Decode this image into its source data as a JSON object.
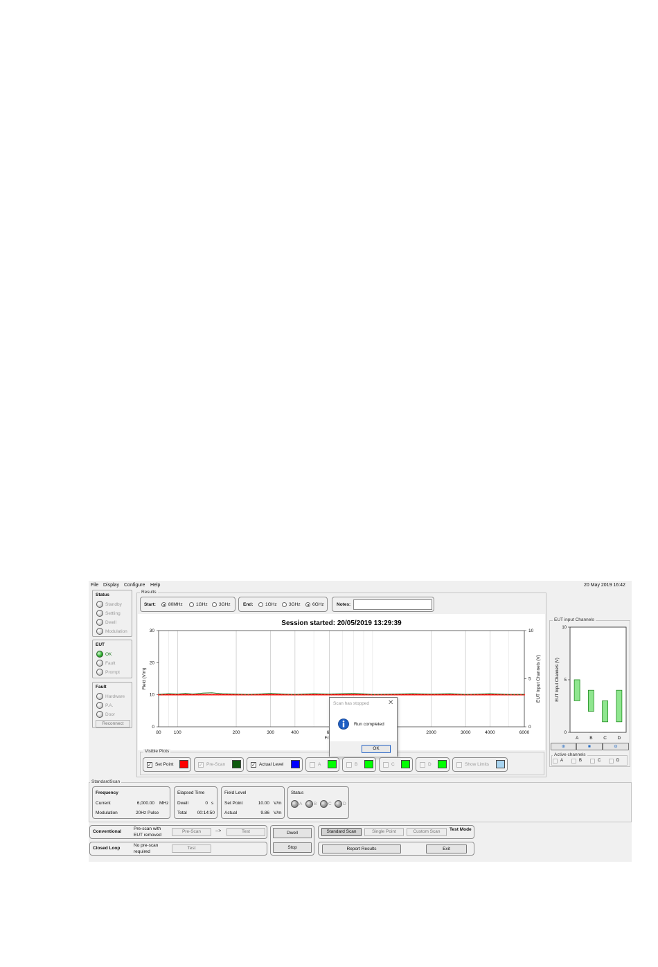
{
  "menu": [
    "File",
    "Display",
    "Configure",
    "Help"
  ],
  "datetime": "20 May 2019 16:42",
  "status_panel": {
    "title": "Status",
    "items": [
      "Standby",
      "Settling",
      "Dwell",
      "Modulation"
    ]
  },
  "eut_panel": {
    "title": "EUT",
    "items": [
      {
        "label": "OK",
        "active": true
      },
      {
        "label": "Fault",
        "active": false
      },
      {
        "label": "Prompt",
        "active": false
      }
    ]
  },
  "fault_panel": {
    "title": "Fault",
    "items": [
      "Hardware",
      "P.A.",
      "Door"
    ],
    "reconnect": "Reconnect"
  },
  "results": {
    "legend": "Results",
    "start_label": "Start:",
    "start_options": [
      "80MHz",
      "1GHz",
      "3GHz"
    ],
    "start_selected": 0,
    "end_label": "End:",
    "end_options": [
      "1GHz",
      "3GHz",
      "6GHz"
    ],
    "end_selected": 2,
    "notes_label": "Notes:",
    "notes_value": ""
  },
  "chart_data": {
    "type": "line",
    "title": "Session started: 20/05/2019 13:29:39",
    "xlabel": "Fre",
    "ylabel": "Field (V/m)",
    "y2label": "EUT Input Channels (V)",
    "xscale": "log",
    "xlim": [
      80,
      6000
    ],
    "xticks": [
      80,
      100,
      200,
      300,
      400,
      600,
      2000,
      3000,
      4000,
      6000
    ],
    "xtick_labels": [
      "80",
      "100",
      "200",
      "300",
      "400",
      "60",
      "2000",
      "3000",
      "4000",
      "6000"
    ],
    "ylim": [
      0,
      30
    ],
    "yticks": [
      0,
      10,
      20,
      30
    ],
    "y2lim": [
      0,
      10
    ],
    "y2ticks": [
      0,
      5,
      10
    ],
    "grid": true,
    "series": [
      {
        "name": "Set Point",
        "color": "#ff0000",
        "x": [
          80,
          6000
        ],
        "y": [
          10,
          10
        ]
      },
      {
        "name": "Actual Level",
        "color": "#1a6e1a",
        "x": [
          80,
          90,
          100,
          110,
          120,
          135,
          150,
          170,
          200,
          230,
          260,
          300,
          350,
          400,
          500,
          600,
          800,
          1000,
          1300,
          1600,
          2000,
          2500,
          3000,
          3500,
          4000,
          5000,
          6000
        ],
        "y": [
          10.1,
          10.3,
          10.2,
          10.4,
          10.2,
          10.5,
          10.6,
          10.3,
          10.2,
          10.1,
          10.2,
          10.4,
          10.2,
          10.1,
          10.3,
          10.2,
          10.4,
          10.1,
          10.2,
          10.3,
          10.2,
          10.3,
          10.1,
          10.2,
          10.3,
          10.1,
          10.1
        ]
      }
    ]
  },
  "dialog": {
    "title": "Scan has stopped",
    "message": "Run completed",
    "ok": "OK"
  },
  "visible_plots": {
    "legend": "Visible Plots",
    "items": [
      {
        "label": "Set Point",
        "checked": true,
        "enabled": true,
        "color": "#ff0000"
      },
      {
        "label": "Pre-Scan",
        "checked": true,
        "enabled": false,
        "color": "#0f5a0f"
      },
      {
        "label": "Actual Level",
        "checked": true,
        "enabled": true,
        "color": "#0000ff"
      },
      {
        "label": "A",
        "checked": false,
        "enabled": false,
        "color": "#00ff00"
      },
      {
        "label": "B",
        "checked": false,
        "enabled": false,
        "color": "#00ff00"
      },
      {
        "label": "C",
        "checked": false,
        "enabled": false,
        "color": "#00ff00"
      },
      {
        "label": "D",
        "checked": false,
        "enabled": false,
        "color": "#00ff00"
      },
      {
        "label": "Show Limits",
        "checked": false,
        "enabled": false,
        "color": "#a8d4f0"
      }
    ]
  },
  "eut_channels": {
    "legend": "EUT input Channels",
    "ylabel": "EUT Input Channels (V)",
    "chart_data": {
      "type": "bar",
      "categories": [
        "A",
        "B",
        "C",
        "D"
      ],
      "ranges": [
        [
          3,
          5
        ],
        [
          2,
          4
        ],
        [
          1,
          3
        ],
        [
          1,
          4
        ]
      ],
      "ylim": [
        0,
        10
      ],
      "yticks": [
        0,
        5,
        10
      ]
    },
    "active_legend": "Active channels",
    "active": [
      "A",
      "B",
      "C",
      "D"
    ]
  },
  "standard_scan": {
    "legend": "StandardScan",
    "frequency": {
      "title": "Frequency",
      "current_label": "Current",
      "current_value": "6,000.00",
      "current_unit": "MHz",
      "modulation_label": "Modulation",
      "modulation_value": "20Hz Pulse"
    },
    "elapsed": {
      "title": "Elapsed Time",
      "dwell_label": "Dwell",
      "dwell_value": "0",
      "dwell_unit": "s",
      "total_label": "Total",
      "total_value": "00:14:50"
    },
    "field_level": {
      "title": "Field Level",
      "setpoint_label": "Set Point",
      "setpoint_value": "10.00",
      "setpoint_unit": "V/m",
      "actual_label": "Actual",
      "actual_value": "9.86",
      "actual_unit": "V/m"
    },
    "status": {
      "title": "Status",
      "channels": [
        "A",
        "B",
        "C",
        "D"
      ]
    }
  },
  "controls": {
    "conventional": {
      "label": "Conventional",
      "desc1": "Pre-scan with",
      "desc2": "EUT removed",
      "prescan": "Pre-Scan",
      "arrow": "-->",
      "test": "Test"
    },
    "closed_loop": {
      "label": "Closed Loop",
      "desc1": "No pre-scan",
      "desc2": "required",
      "test": "Test"
    },
    "dwell": "Dwell",
    "stop": "Stop",
    "modes": [
      "Standard Scan",
      "Single Point",
      "Custom Scan"
    ],
    "test_mode_label": "Test Mode",
    "report": "Report Results",
    "exit": "Exit"
  }
}
